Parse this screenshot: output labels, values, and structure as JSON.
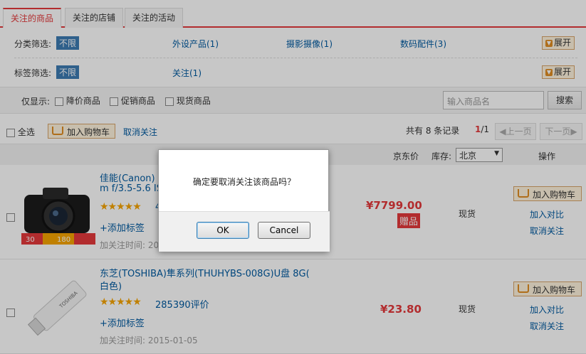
{
  "tabs": [
    "关注的商品",
    "关注的店铺",
    "关注的活动"
  ],
  "filters": {
    "category_label": "分类筛选:",
    "category_all": "不限",
    "category_items": [
      "外设产品(1)",
      "摄影摄像(1)",
      "数码配件(3)"
    ],
    "tag_label": "标签筛选:",
    "tag_all": "不限",
    "tag_items": [
      "关注(1)"
    ],
    "expand_label": "展开"
  },
  "show_only": {
    "label": "仅显示:",
    "options": [
      "降价商品",
      "促销商品",
      "现货商品"
    ],
    "search_placeholder": "输入商品名",
    "search_button": "搜索"
  },
  "toolbar": {
    "select_all": "全选",
    "add_to_cart": "加入购物车",
    "cancel_follow": "取消关注",
    "total_text": "共有 8 条记录",
    "page_current": "1",
    "page_total": "/1",
    "prev": "上一页",
    "next": "下一页"
  },
  "columns": {
    "price": "京东价",
    "stock": "库存:",
    "region": "北京",
    "action": "操作"
  },
  "items": [
    {
      "title_line1": "佳能(Canon)",
      "title_line2": "m f/3.5-5.6 IS",
      "rating_partial": "4",
      "add_tag": "+添加标签",
      "followed_time": "加关注时间: 20",
      "price": "¥7799.00",
      "gift": "赠品",
      "stock": "现货",
      "add_cart": "加入购物车",
      "compare": "加入对比",
      "unfollow": "取消关注",
      "promo_a": "30",
      "promo_b": "180"
    },
    {
      "title_line1": "东芝(TOSHIBA)隼系列(THUHYBS-008G)U盘 8G(",
      "title_line2": "白色)",
      "reviews": "285390评价",
      "add_tag": "+添加标签",
      "followed_time": "加关注时间: 2015-01-05",
      "price": "¥23.80",
      "stock": "现货",
      "add_cart": "加入购物车",
      "compare": "加入对比",
      "unfollow": "取消关注"
    }
  ],
  "dialog": {
    "message": "确定要取消关注该商品吗？",
    "ok": "OK",
    "cancel": "Cancel"
  }
}
